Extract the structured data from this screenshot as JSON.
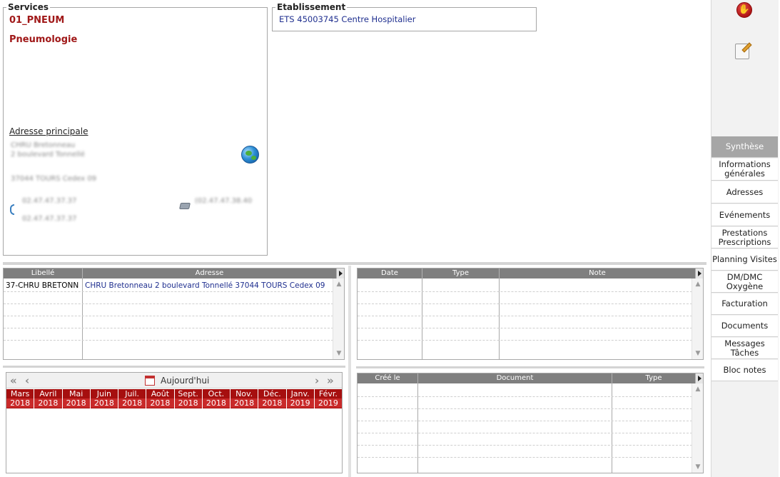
{
  "services": {
    "legend": "Services",
    "code": "01_PNEUM",
    "name": "Pneumologie",
    "address_title": "Adresse principale",
    "address_line1": "CHRU Bretonneau",
    "address_line2": "2 boulevard Tonnellé",
    "address_city": "37044 TOURS Cedex 09",
    "phone1": "02.47.47.37.37",
    "phone2": "02.47.47.37.37",
    "fax": "(02.47.47.38.40"
  },
  "etablissement": {
    "legend": "Etablissement",
    "value": "ETS 45003745 Centre Hospitalier"
  },
  "sidebar": {
    "stop_icon": "stop-hand-icon",
    "notes_icon": "notepad-pencil-icon",
    "items": [
      {
        "label": "Synthèse",
        "active": true
      },
      {
        "label": "Informations générales"
      },
      {
        "label": "Adresses"
      },
      {
        "label": "Evénements"
      },
      {
        "label": "Prestations Prescriptions"
      },
      {
        "label": "Planning Visites"
      },
      {
        "label": "DM/DMC Oxygène"
      },
      {
        "label": "Facturation"
      },
      {
        "label": "Documents"
      },
      {
        "label": "Messages Tâches"
      },
      {
        "label": "Bloc notes"
      }
    ]
  },
  "addresses_grid": {
    "columns": [
      "Libellé",
      "Adresse"
    ],
    "rows": [
      {
        "libelle": "37-CHRU BRETONN",
        "adresse": "CHRU Bretonneau 2 boulevard Tonnellé 37044 TOURS Cedex 09"
      }
    ]
  },
  "events_grid": {
    "columns": [
      "Date",
      "Type",
      "Note"
    ]
  },
  "documents_grid": {
    "columns": [
      "Créé le",
      "Document",
      "Type"
    ]
  },
  "calendar": {
    "today_label": "Aujourd'hui",
    "months": [
      {
        "m": "Mars",
        "y": "2018"
      },
      {
        "m": "Avril",
        "y": "2018"
      },
      {
        "m": "Mai",
        "y": "2018"
      },
      {
        "m": "Juin",
        "y": "2018"
      },
      {
        "m": "Juil.",
        "y": "2018"
      },
      {
        "m": "Août",
        "y": "2018"
      },
      {
        "m": "Sept.",
        "y": "2018"
      },
      {
        "m": "Oct.",
        "y": "2018"
      },
      {
        "m": "Nov.",
        "y": "2018"
      },
      {
        "m": "Déc.",
        "y": "2018"
      },
      {
        "m": "Janv.",
        "y": "2019"
      },
      {
        "m": "Févr.",
        "y": "2019"
      }
    ]
  },
  "colors": {
    "accent_red": "#a01818",
    "header_gray": "#7f7f7f",
    "link_blue": "#1f2f8f"
  }
}
